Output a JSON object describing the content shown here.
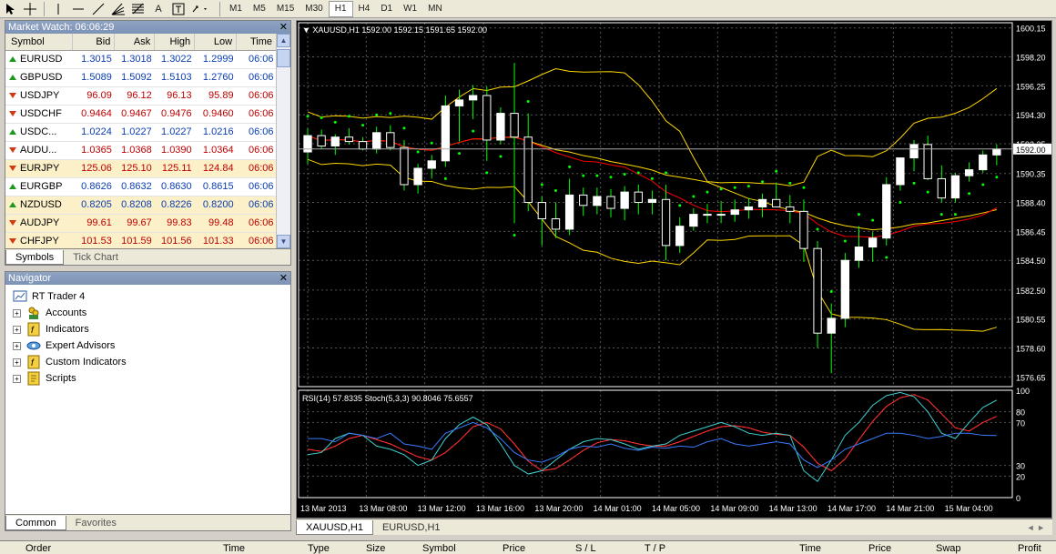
{
  "toolbar": {
    "tools": [
      "cursor-icon",
      "crosshair-icon",
      "vertical-line-icon",
      "horizontal-line-icon",
      "trendline-icon",
      "fibo-fan-icon",
      "fibo-icon",
      "text-icon",
      "text-label-icon",
      "arrows-icon"
    ],
    "text_tool": "A",
    "timeframes": [
      "M1",
      "M5",
      "M15",
      "M30",
      "H1",
      "H4",
      "D1",
      "W1",
      "MN"
    ],
    "active_timeframe": "H1"
  },
  "market_watch": {
    "title": "Market Watch: 06:06:29",
    "columns": [
      "Symbol",
      "Bid",
      "Ask",
      "High",
      "Low",
      "Time"
    ],
    "rows": [
      {
        "symbol": "EURUSD",
        "bid": "1.3015",
        "ask": "1.3018",
        "high": "1.3022",
        "low": "1.2999",
        "time": "06:06",
        "dir": "up",
        "hl": false
      },
      {
        "symbol": "GBPUSD",
        "bid": "1.5089",
        "ask": "1.5092",
        "high": "1.5103",
        "low": "1.2760",
        "time": "06:06",
        "dir": "up",
        "hl": false
      },
      {
        "symbol": "USDJPY",
        "bid": "96.09",
        "ask": "96.12",
        "high": "96.13",
        "low": "95.89",
        "time": "06:06",
        "dir": "down",
        "hl": false
      },
      {
        "symbol": "USDCHF",
        "bid": "0.9464",
        "ask": "0.9467",
        "high": "0.9476",
        "low": "0.9460",
        "time": "06:06",
        "dir": "down",
        "hl": false
      },
      {
        "symbol": "USDC...",
        "bid": "1.0224",
        "ask": "1.0227",
        "high": "1.0227",
        "low": "1.0216",
        "time": "06:06",
        "dir": "up",
        "hl": false
      },
      {
        "symbol": "AUDU...",
        "bid": "1.0365",
        "ask": "1.0368",
        "high": "1.0390",
        "low": "1.0364",
        "time": "06:06",
        "dir": "down",
        "hl": false
      },
      {
        "symbol": "EURJPY",
        "bid": "125.06",
        "ask": "125.10",
        "high": "125.11",
        "low": "124.84",
        "time": "06:06",
        "dir": "down",
        "hl": true
      },
      {
        "symbol": "EURGBP",
        "bid": "0.8626",
        "ask": "0.8632",
        "high": "0.8630",
        "low": "0.8615",
        "time": "06:06",
        "dir": "up",
        "hl": false
      },
      {
        "symbol": "NZDUSD",
        "bid": "0.8205",
        "ask": "0.8208",
        "high": "0.8226",
        "low": "0.8200",
        "time": "06:06",
        "dir": "up",
        "hl": true
      },
      {
        "symbol": "AUDJPY",
        "bid": "99.61",
        "ask": "99.67",
        "high": "99.83",
        "low": "99.48",
        "time": "06:06",
        "dir": "down",
        "hl": true
      },
      {
        "symbol": "CHFJPY",
        "bid": "101.53",
        "ask": "101.59",
        "high": "101.56",
        "low": "101.33",
        "time": "06:06",
        "dir": "down",
        "hl": true
      }
    ],
    "tabs": [
      "Symbols",
      "Tick Chart"
    ],
    "active_tab": "Symbols"
  },
  "navigator": {
    "title": "Navigator",
    "root": "RT Trader 4",
    "items": [
      "Accounts",
      "Indicators",
      "Expert Advisors",
      "Custom Indicators",
      "Scripts"
    ],
    "tabs": [
      "Common",
      "Favorites"
    ],
    "active_tab": "Common"
  },
  "chart": {
    "header": "XAUUSD,H1  1592.00 1592.15 1591.65 1592.00",
    "indicator_header": "RSI(14) 57.8335  Stoch(5,3,3) 90.8046 75.6557",
    "price_labels": [
      "1600.15",
      "1598.20",
      "1596.25",
      "1594.30",
      "1592.35",
      "1590.35",
      "1588.40",
      "1586.45",
      "1584.50",
      "1582.50",
      "1580.55",
      "1578.60",
      "1576.65"
    ],
    "current_price": "1592.00",
    "osc_labels": [
      "100",
      "80",
      "70",
      "30",
      "20",
      "0"
    ],
    "time_labels": [
      "13 Mar 2013",
      "13 Mar 08:00",
      "13 Mar 12:00",
      "13 Mar 16:00",
      "13 Mar 20:00",
      "14 Mar 01:00",
      "14 Mar 05:00",
      "14 Mar 09:00",
      "14 Mar 13:00",
      "14 Mar 17:00",
      "14 Mar 21:00",
      "15 Mar 04:00"
    ],
    "tabs": [
      "XAUUSD,H1",
      "EURUSD,H1"
    ],
    "active_tab": "XAUUSD,H1",
    "colors": {
      "up": "#00ff00",
      "bullish_body": "#ffffff",
      "bearish_body": "#000000",
      "wick": "#00ff00",
      "band": "#ffd700",
      "ma_red": "#ff0000",
      "ma_yellow": "#ffd700",
      "rsi": "#3a7bff",
      "stoch_main": "#40d0d0",
      "stoch_signal": "#ff3030",
      "grid": "#555555",
      "sar": "#00ff00"
    }
  },
  "chart_data": {
    "type": "candlestick",
    "symbol": "XAUUSD",
    "timeframe": "H1",
    "ylim": [
      1576.0,
      1600.5
    ],
    "candles": [
      [
        1591.8,
        1593.4,
        1591.0,
        1592.9
      ],
      [
        1592.9,
        1593.3,
        1592.0,
        1592.2
      ],
      [
        1592.2,
        1593.0,
        1591.6,
        1592.8
      ],
      [
        1592.8,
        1593.4,
        1592.3,
        1592.5
      ],
      [
        1592.5,
        1592.8,
        1591.9,
        1592.0
      ],
      [
        1592.0,
        1593.5,
        1591.7,
        1593.1
      ],
      [
        1593.1,
        1593.6,
        1591.9,
        1592.1
      ],
      [
        1592.1,
        1592.6,
        1589.2,
        1589.6
      ],
      [
        1589.6,
        1591.0,
        1589.0,
        1590.7
      ],
      [
        1590.7,
        1591.6,
        1590.0,
        1591.2
      ],
      [
        1591.2,
        1595.6,
        1590.8,
        1594.9
      ],
      [
        1594.9,
        1596.0,
        1592.5,
        1595.3
      ],
      [
        1595.3,
        1596.3,
        1594.0,
        1595.6
      ],
      [
        1595.6,
        1596.2,
        1591.2,
        1592.6
      ],
      [
        1592.6,
        1594.8,
        1592.3,
        1594.4
      ],
      [
        1594.4,
        1597.8,
        1587.0,
        1592.8
      ],
      [
        1592.8,
        1594.4,
        1587.8,
        1588.4
      ],
      [
        1588.4,
        1588.8,
        1585.5,
        1587.3
      ],
      [
        1587.3,
        1588.4,
        1586.0,
        1586.6
      ],
      [
        1586.6,
        1590.0,
        1586.2,
        1588.9
      ],
      [
        1588.9,
        1589.4,
        1587.5,
        1588.2
      ],
      [
        1588.2,
        1589.4,
        1587.6,
        1588.8
      ],
      [
        1588.8,
        1589.3,
        1587.4,
        1588.0
      ],
      [
        1588.0,
        1589.5,
        1587.2,
        1589.1
      ],
      [
        1589.1,
        1589.6,
        1587.6,
        1588.4
      ],
      [
        1588.4,
        1589.2,
        1587.6,
        1588.6
      ],
      [
        1588.6,
        1589.6,
        1584.5,
        1585.5
      ],
      [
        1585.5,
        1587.4,
        1585.0,
        1586.8
      ],
      [
        1586.8,
        1588.0,
        1586.5,
        1587.6
      ],
      [
        1587.6,
        1588.3,
        1587.0,
        1587.6
      ],
      [
        1587.6,
        1588.5,
        1587.0,
        1587.6
      ],
      [
        1587.6,
        1588.6,
        1587.1,
        1587.9
      ],
      [
        1587.9,
        1588.7,
        1587.3,
        1588.1
      ],
      [
        1588.1,
        1589.0,
        1587.4,
        1588.6
      ],
      [
        1588.6,
        1589.7,
        1588.2,
        1588.1
      ],
      [
        1588.1,
        1588.9,
        1587.0,
        1587.8
      ],
      [
        1587.8,
        1588.6,
        1584.4,
        1585.3
      ],
      [
        1585.3,
        1585.8,
        1578.6,
        1579.6
      ],
      [
        1579.6,
        1581.6,
        1576.9,
        1580.6
      ],
      [
        1580.6,
        1585.0,
        1580.0,
        1584.5
      ],
      [
        1584.5,
        1586.8,
        1584.0,
        1585.4
      ],
      [
        1585.4,
        1586.4,
        1584.4,
        1586.0
      ],
      [
        1586.0,
        1590.1,
        1585.5,
        1589.6
      ],
      [
        1589.6,
        1591.0,
        1589.2,
        1591.4
      ],
      [
        1591.4,
        1592.6,
        1590.5,
        1592.3
      ],
      [
        1592.3,
        1592.9,
        1589.9,
        1590.0
      ],
      [
        1590.0,
        1590.9,
        1588.4,
        1588.7
      ],
      [
        1588.7,
        1590.4,
        1588.4,
        1590.2
      ],
      [
        1590.2,
        1591.1,
        1589.8,
        1590.6
      ],
      [
        1590.6,
        1591.9,
        1590.4,
        1591.6
      ],
      [
        1591.6,
        1592.3,
        1590.9,
        1592.0
      ]
    ],
    "rsi_values": [
      55,
      55,
      52,
      60,
      58,
      55,
      60,
      50,
      48,
      45,
      60,
      65,
      70,
      65,
      55,
      42,
      35,
      33,
      38,
      45,
      48,
      47,
      50,
      46,
      44,
      47,
      46,
      48,
      47,
      52,
      55,
      50,
      48,
      50,
      52,
      50,
      35,
      28,
      35,
      45,
      50,
      55,
      60,
      60,
      58,
      55,
      57,
      60,
      60,
      58,
      57.8
    ],
    "stoch_main": [
      40,
      42,
      55,
      60,
      58,
      48,
      45,
      40,
      30,
      35,
      55,
      68,
      75,
      68,
      50,
      30,
      22,
      25,
      35,
      45,
      52,
      55,
      54,
      50,
      45,
      48,
      50,
      58,
      62,
      66,
      70,
      66,
      60,
      58,
      60,
      58,
      25,
      15,
      35,
      58,
      70,
      86,
      95,
      98,
      94,
      80,
      60,
      55,
      70,
      84,
      90.8
    ],
    "stoch_signal": [
      45,
      43,
      48,
      55,
      58,
      54,
      50,
      44,
      38,
      35,
      42,
      53,
      66,
      70,
      64,
      50,
      34,
      25,
      27,
      35,
      44,
      51,
      54,
      53,
      50,
      48,
      48,
      52,
      57,
      62,
      66,
      67,
      65,
      61,
      59,
      58,
      47,
      32,
      25,
      36,
      54,
      71,
      85,
      93,
      96,
      91,
      78,
      65,
      62,
      70,
      75.7
    ]
  },
  "terminal": {
    "columns": [
      "Order",
      "Time",
      "Type",
      "Size",
      "Symbol",
      "Price",
      "S / L",
      "T / P",
      "Time",
      "Price",
      "Swap",
      "Profit"
    ]
  }
}
